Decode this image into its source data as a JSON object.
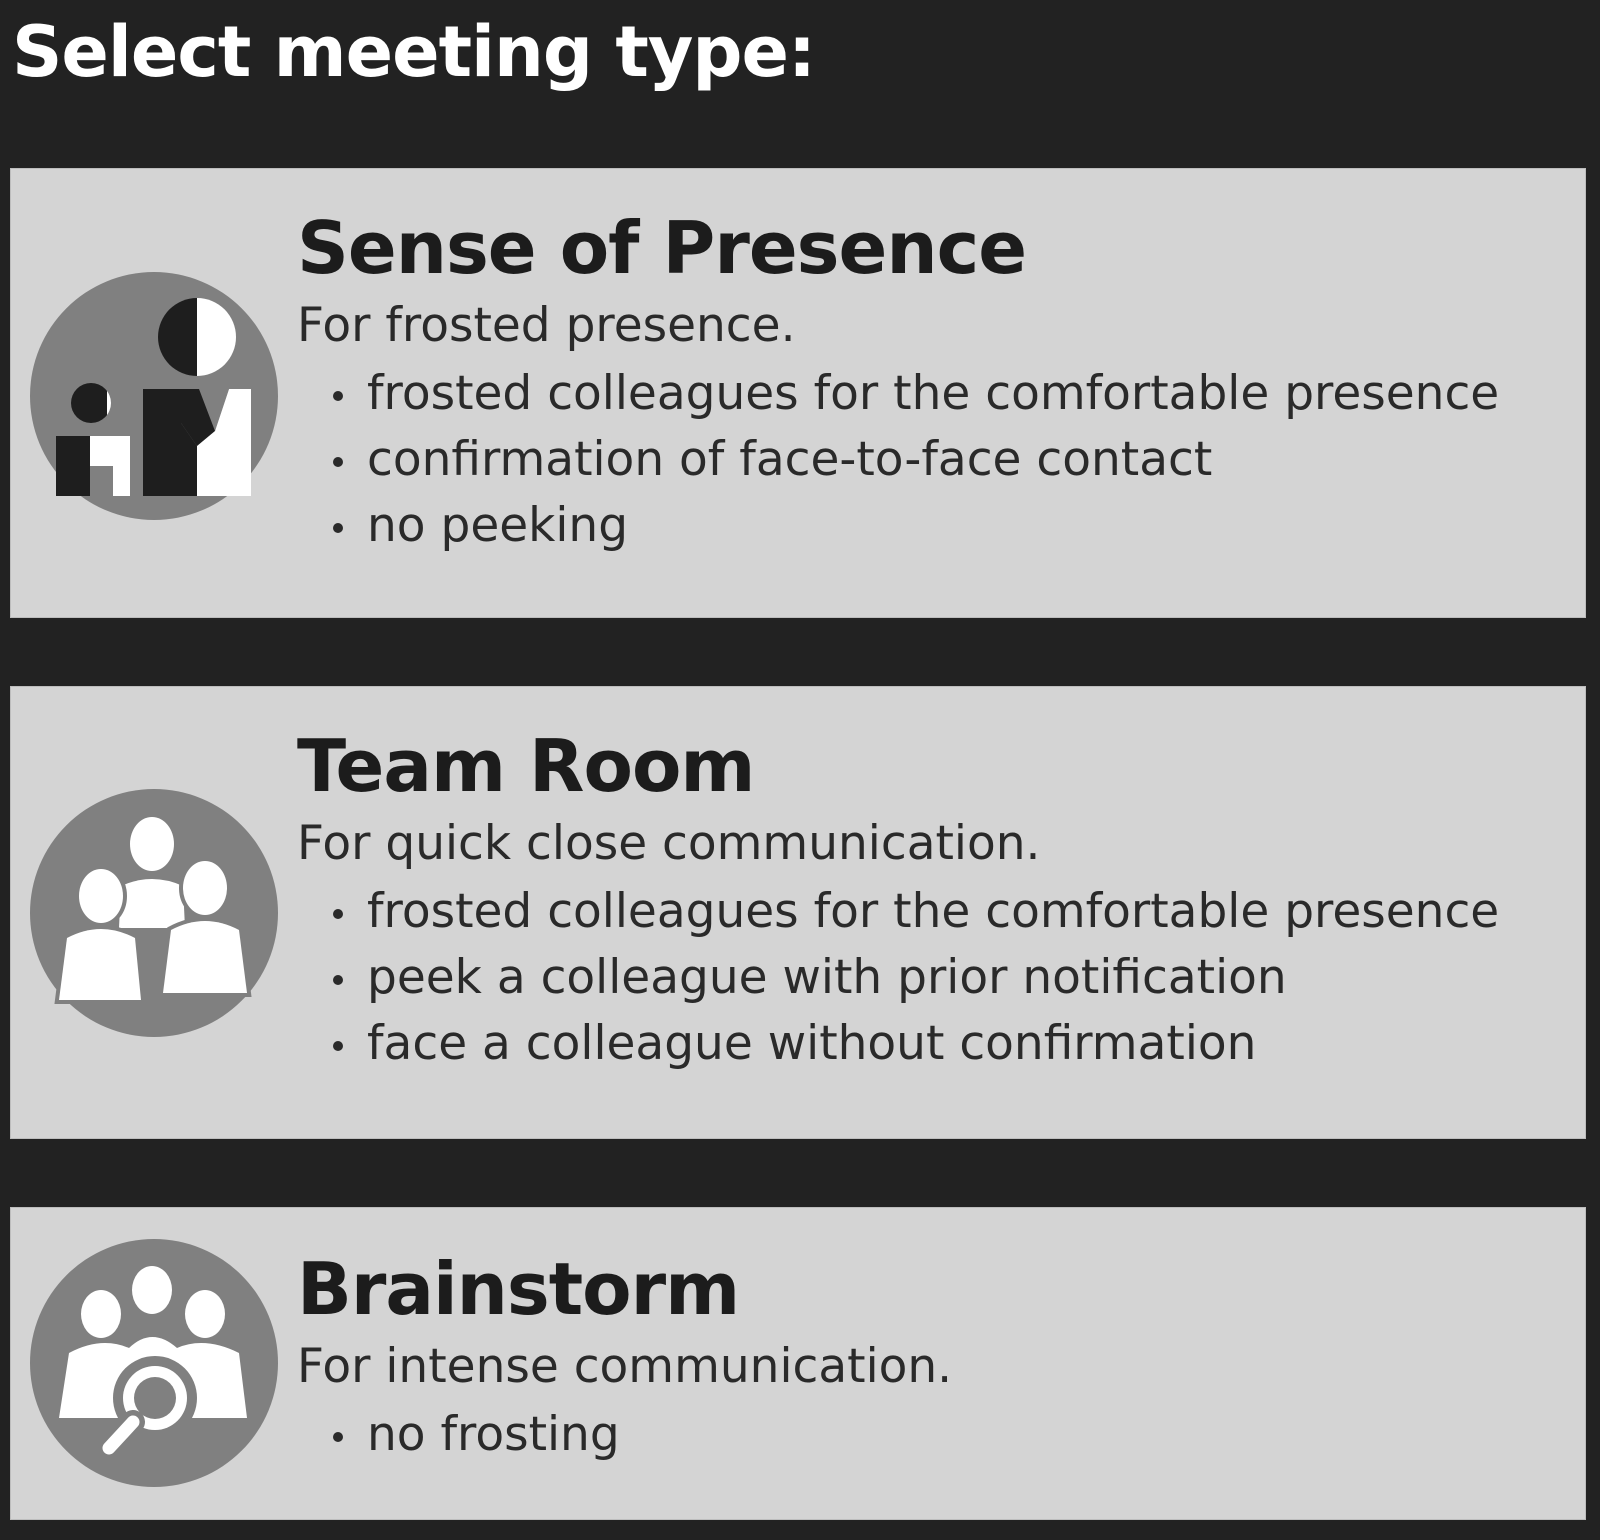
{
  "page": {
    "title": "Select meeting type:"
  },
  "colors": {
    "background": "#222222",
    "card": "#d4d4d4",
    "icon_circle": "#808080",
    "text": "#1c1c1c"
  },
  "meeting_types": [
    {
      "icon": "sense-of-presence-icon",
      "title": "Sense of Presence",
      "subtitle": "For frosted presence.",
      "bullets": [
        "frosted colleagues for the comfortable presence",
        "confirmation of face-to-face contact",
        "no peeking"
      ]
    },
    {
      "icon": "team-room-icon",
      "title": "Team Room",
      "subtitle": "For quick close communication.",
      "bullets": [
        "frosted colleagues for the comfortable presence",
        "peek a colleague with prior notification",
        "face a colleague without confirmation"
      ]
    },
    {
      "icon": "brainstorm-icon",
      "title": "Brainstorm",
      "subtitle": "For intense communication.",
      "bullets": [
        "no frosting"
      ]
    }
  ]
}
